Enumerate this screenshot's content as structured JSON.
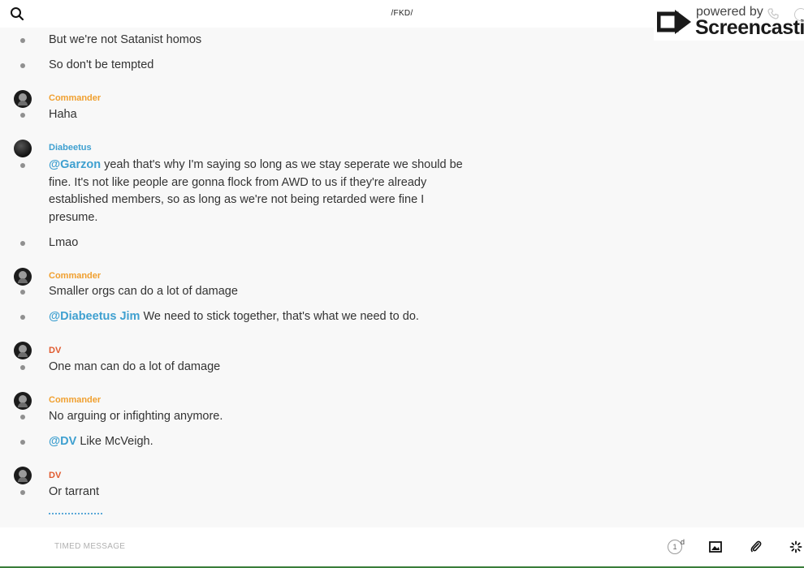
{
  "header": {
    "title": "/FKD/",
    "search_icon": "search-icon"
  },
  "watermark": {
    "small": "powered by",
    "big": "Screencastify"
  },
  "feed": {
    "messages": [
      {
        "text": "But we're not Satanist homos"
      },
      {
        "text": "So don't be tempted"
      },
      {
        "author": "Commander",
        "text": "Haha"
      },
      {
        "author": "Diabeetus",
        "mention": "@Garzon",
        "text": " yeah that's why I'm saying so long as we stay seperate we should be fine. It's not like people are gonna flock from AWD to us if they're already established members, so as long as we're not being retarded were fine I presume."
      },
      {
        "text": "Lmao"
      },
      {
        "author": "Commander",
        "text": "Smaller orgs can do a lot of damage"
      },
      {
        "mention": "@Diabeetus Jim",
        "text": " We need to stick together, that's what we need to do."
      },
      {
        "author": "DV",
        "text": "One man can do a lot of damage"
      },
      {
        "author": "Commander",
        "text": "No arguing or infighting anymore."
      },
      {
        "mention": "@DV",
        "text": " Like McVeigh."
      },
      {
        "author": "DV",
        "text": "Or tarrant"
      }
    ]
  },
  "composer": {
    "timed_label": "TIMED MESSAGE",
    "timer_value": "1",
    "timer_unit": "d"
  },
  "colors": {
    "commander": "#f0a030",
    "diabeetus": "#3fa0d0",
    "dv": "#e05a2e",
    "mention": "#3fa0d0"
  }
}
